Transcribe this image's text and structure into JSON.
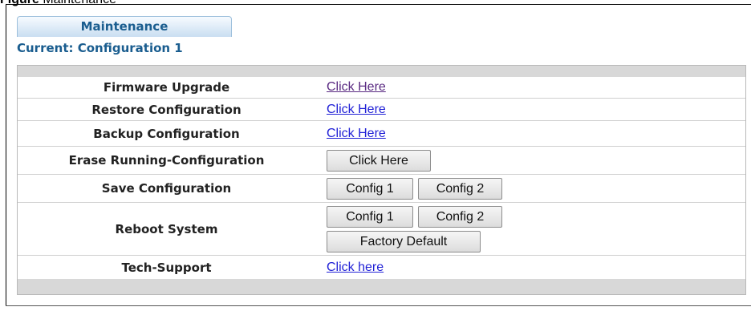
{
  "caption": {
    "label": "Figure",
    "text": "Maintenance"
  },
  "tab": {
    "label": "Maintenance"
  },
  "current": {
    "text": "Current: Configuration 1"
  },
  "rows": {
    "firmware_upgrade": {
      "label": "Firmware Upgrade",
      "link": "Click Here"
    },
    "restore_configuration": {
      "label": "Restore Configuration",
      "link": "Click Here"
    },
    "backup_configuration": {
      "label": "Backup Configuration",
      "link": "Click Here"
    },
    "erase_running_configuration": {
      "label": "Erase Running-Configuration",
      "button": "Click Here"
    },
    "save_configuration": {
      "label": "Save Configuration",
      "config1": "Config 1",
      "config2": "Config 2"
    },
    "reboot_system": {
      "label": "Reboot System",
      "config1": "Config 1",
      "config2": "Config 2",
      "factory_default": "Factory Default"
    },
    "tech_support": {
      "label": "Tech-Support",
      "link": "Click here"
    }
  },
  "colors": {
    "tab_text": "#1a5d8f",
    "link": "#1f1fd6",
    "visited_link": "#5a2a82",
    "bar": "#d8d8d8"
  }
}
